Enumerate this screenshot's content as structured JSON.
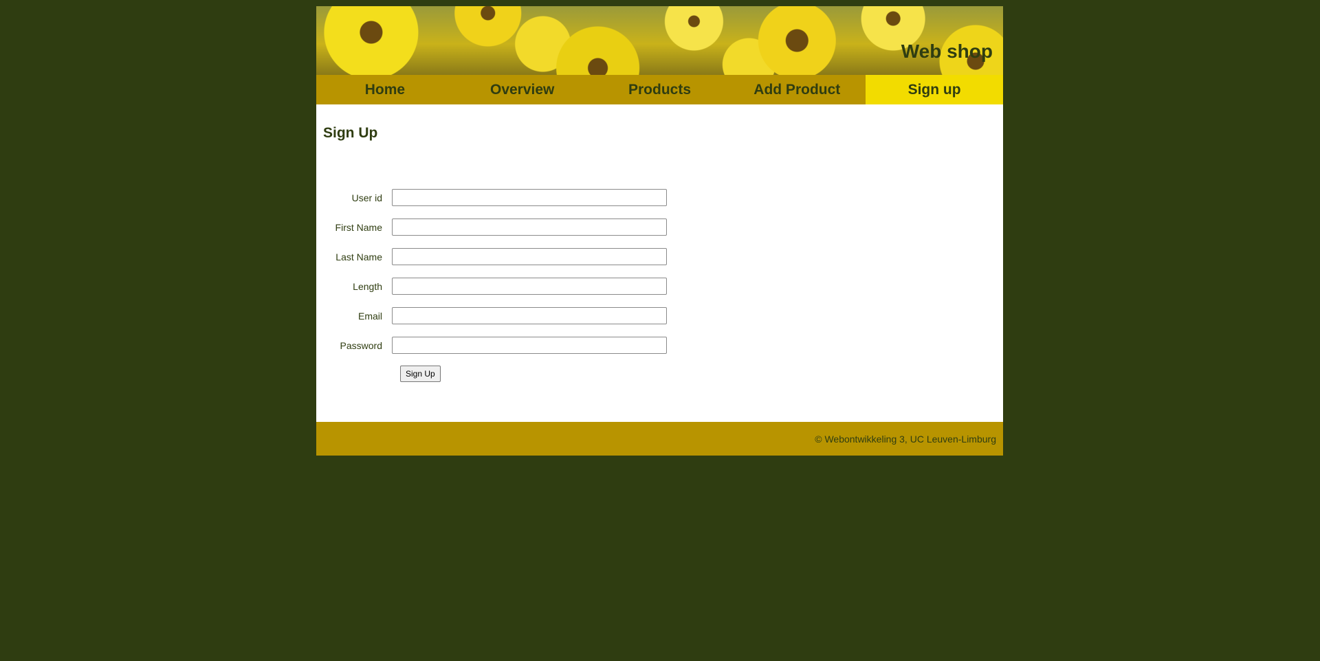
{
  "header": {
    "site_title": "Web shop"
  },
  "nav": {
    "items": [
      {
        "label": "Home"
      },
      {
        "label": "Overview"
      },
      {
        "label": "Products"
      },
      {
        "label": "Add Product"
      },
      {
        "label": "Sign up"
      }
    ],
    "active": "Sign up"
  },
  "main": {
    "title": "Sign Up"
  },
  "form": {
    "fields": [
      {
        "label": "User id",
        "value": ""
      },
      {
        "label": "First Name",
        "value": ""
      },
      {
        "label": "Last Name",
        "value": ""
      },
      {
        "label": "Length",
        "value": ""
      },
      {
        "label": "Email",
        "value": ""
      },
      {
        "label": "Password",
        "value": ""
      }
    ],
    "submit_label": "Sign Up"
  },
  "footer": {
    "text": "© Webontwikkeling 3, UC Leuven-Limburg"
  },
  "colors": {
    "page_background": "#2f3d11",
    "nav_background": "#b89400",
    "nav_active": "#f2dc00",
    "text": "#2f3d11",
    "content_background": "#ffffff"
  }
}
